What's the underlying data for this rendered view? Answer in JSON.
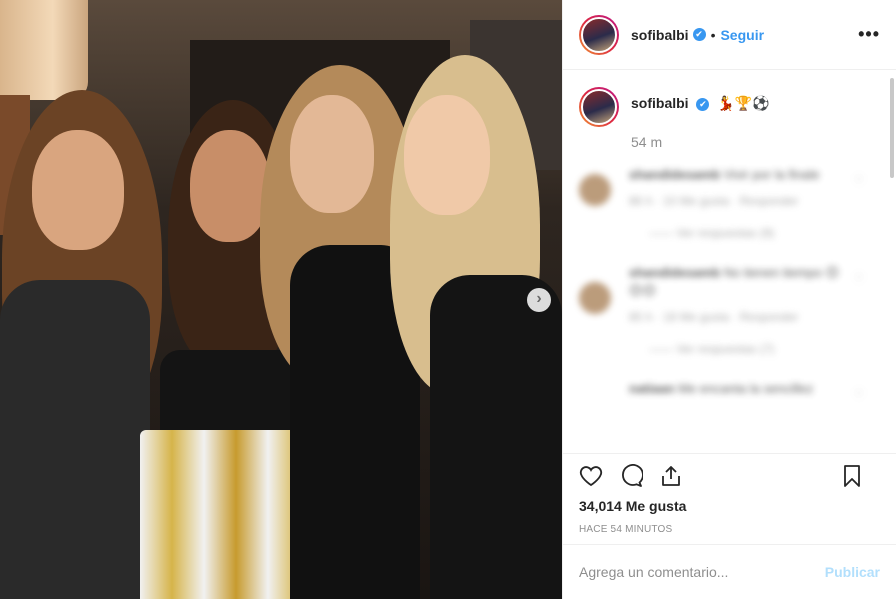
{
  "post": {
    "username": "sofibalbi",
    "verified_glyph": "✔",
    "dot": "•",
    "follow_label": "Seguir",
    "more_label": "•••",
    "caption_emojis": "💃🏆⚽",
    "time_short": "54 m",
    "likes": "34,014 Me gusta",
    "time_ago": "HACE 54 MINUTOS",
    "carousel_next": "›"
  },
  "comments": [
    {
      "user": "shandidesamb",
      "text": "Vivir por la finale",
      "meta": "86 h · 10 Me gusta · Responder",
      "replies": "—— Ver respuestas (9)"
    },
    {
      "user": "shandidesamb",
      "text": "No tienen tiempo 😊😊😊",
      "meta": "85 h · 18 Me gusta · Responder",
      "replies": "—— Ver respuestas (7)"
    },
    {
      "user": "natiaan",
      "text": "Me encanta la sencillez",
      "meta": "",
      "replies": ""
    }
  ],
  "comment_box": {
    "placeholder": "Agrega un comentario...",
    "publish_label": "Publicar"
  },
  "icons": [
    "heart-icon",
    "comment-icon",
    "share-icon",
    "bookmark-icon",
    "verified-icon",
    "more-icon",
    "chevron-right-icon"
  ],
  "colors": {
    "link": "#3897f0",
    "publish_disabled": "#b2dffc",
    "muted": "#8e8e8e",
    "text": "#262626"
  }
}
